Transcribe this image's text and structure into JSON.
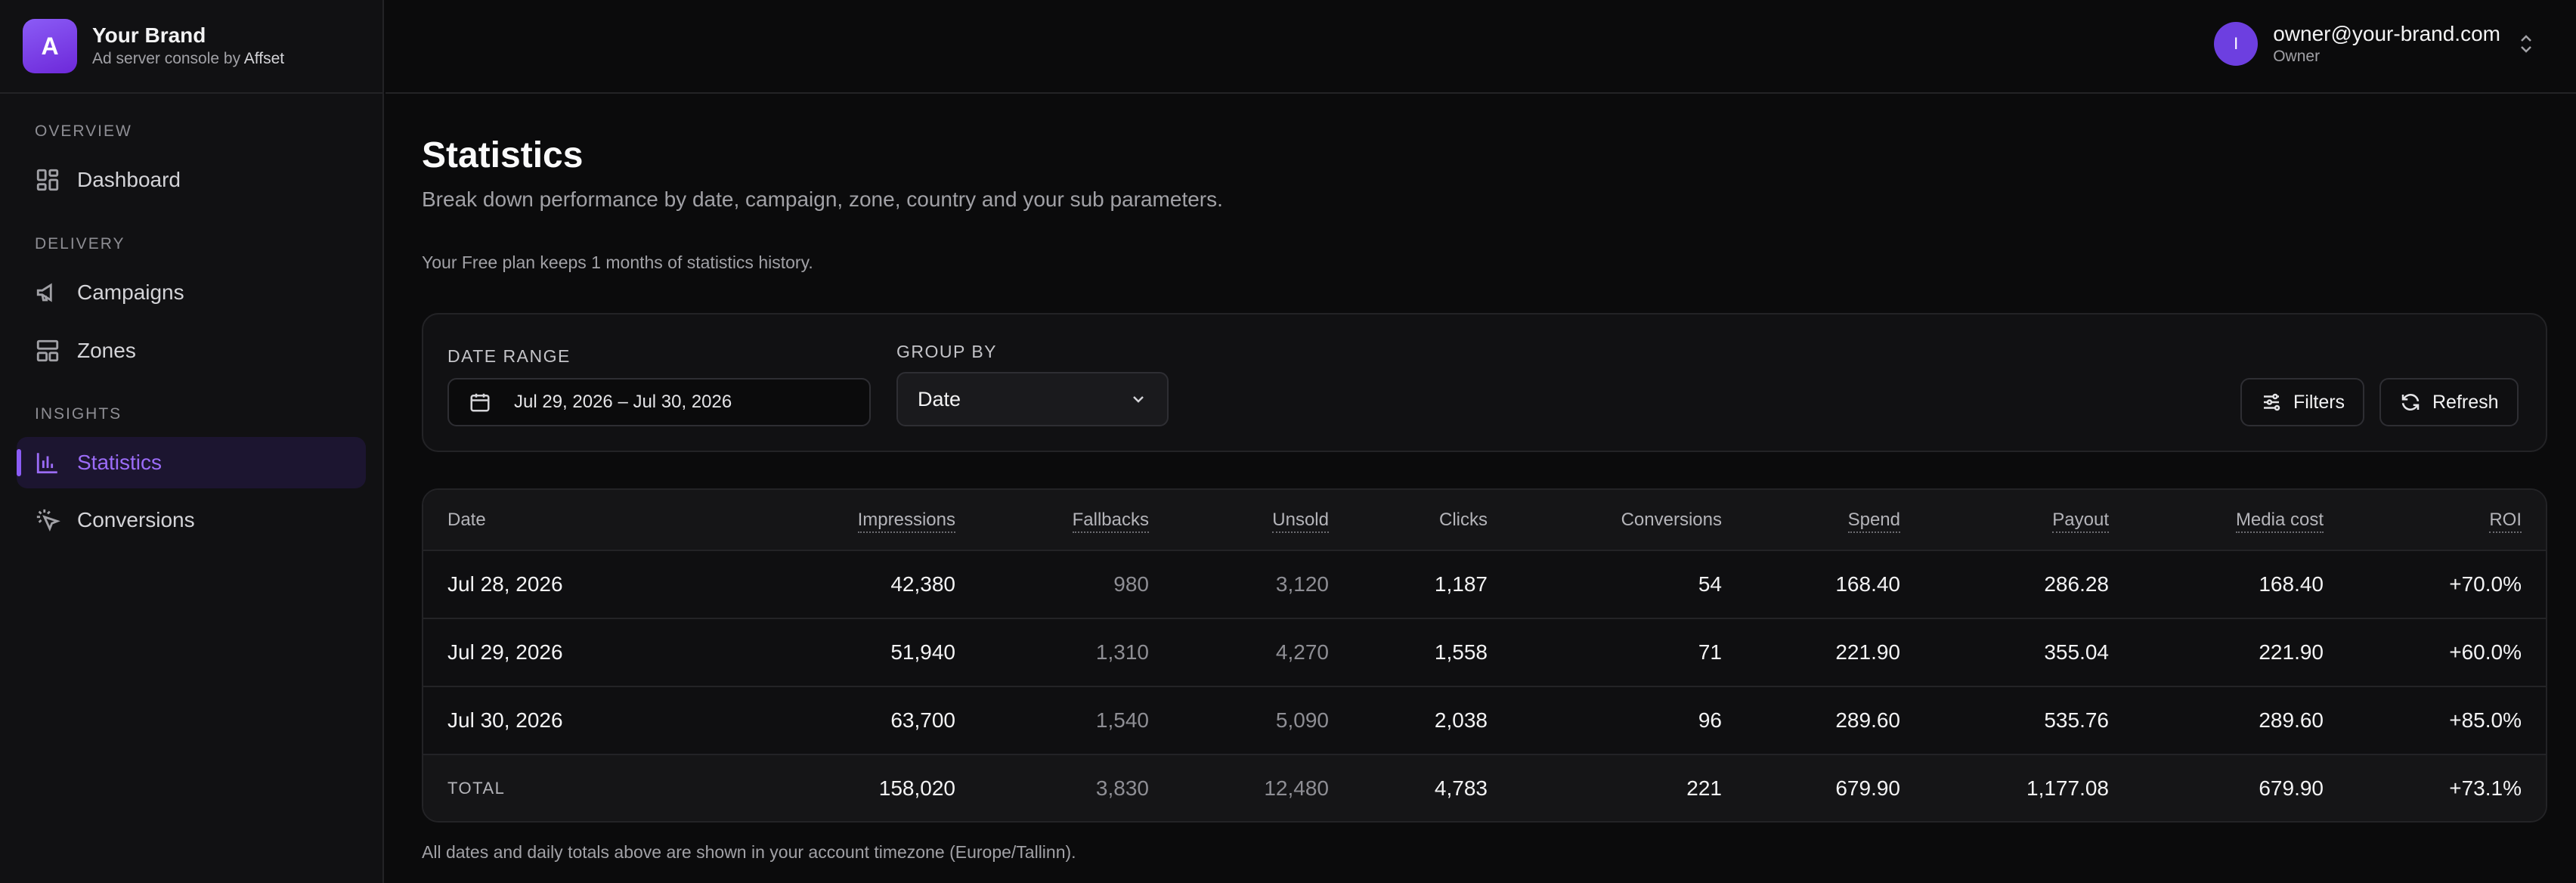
{
  "brand": {
    "logo_letter": "A",
    "name": "Your Brand",
    "subtitle_prefix": "Ad server console by",
    "subtitle_vendor": "Affset"
  },
  "sidebar": {
    "sections": {
      "overview": "OVERVIEW",
      "delivery": "DELIVERY",
      "insights": "INSIGHTS"
    },
    "items": {
      "dashboard": "Dashboard",
      "campaigns": "Campaigns",
      "zones": "Zones",
      "statistics": "Statistics",
      "conversions": "Conversions"
    },
    "active": "statistics"
  },
  "user": {
    "avatar_letter": "I",
    "email": "owner@your-brand.com",
    "role": "Owner"
  },
  "page": {
    "title": "Statistics",
    "description": "Break down performance by date, campaign, zone, country and your sub parameters.",
    "plan_note": "Your Free plan keeps 1 months of statistics history.",
    "timezone_note": "All dates and daily totals above are shown in your account timezone (Europe/Tallinn)."
  },
  "filters": {
    "date_range_label": "DATE RANGE",
    "date_range_value": "Jul 29, 2026 – Jul 30, 2026",
    "group_by_label": "GROUP BY",
    "group_by_value": "Date",
    "filters_button": "Filters",
    "refresh_button": "Refresh"
  },
  "table": {
    "columns": [
      "Date",
      "Impressions",
      "Fallbacks",
      "Unsold",
      "Clicks",
      "Conversions",
      "Spend",
      "Payout",
      "Media cost",
      "ROI"
    ],
    "rows": [
      [
        "Jul 28, 2026",
        "42,380",
        "980",
        "3,120",
        "1,187",
        "54",
        "168.40",
        "286.28",
        "168.40",
        "+70.0%"
      ],
      [
        "Jul 29, 2026",
        "51,940",
        "1,310",
        "4,270",
        "1,558",
        "71",
        "221.90",
        "355.04",
        "221.90",
        "+60.0%"
      ],
      [
        "Jul 30, 2026",
        "63,700",
        "1,540",
        "5,090",
        "2,038",
        "96",
        "289.60",
        "535.76",
        "289.60",
        "+85.0%"
      ]
    ],
    "total": [
      "TOTAL",
      "158,020",
      "3,830",
      "12,480",
      "4,783",
      "221",
      "679.90",
      "1,177.08",
      "679.90",
      "+73.1%"
    ]
  },
  "colors": {
    "accent": "#8b5cf6",
    "background": "#0b0b0c",
    "panel": "#111113",
    "border": "#232326"
  }
}
